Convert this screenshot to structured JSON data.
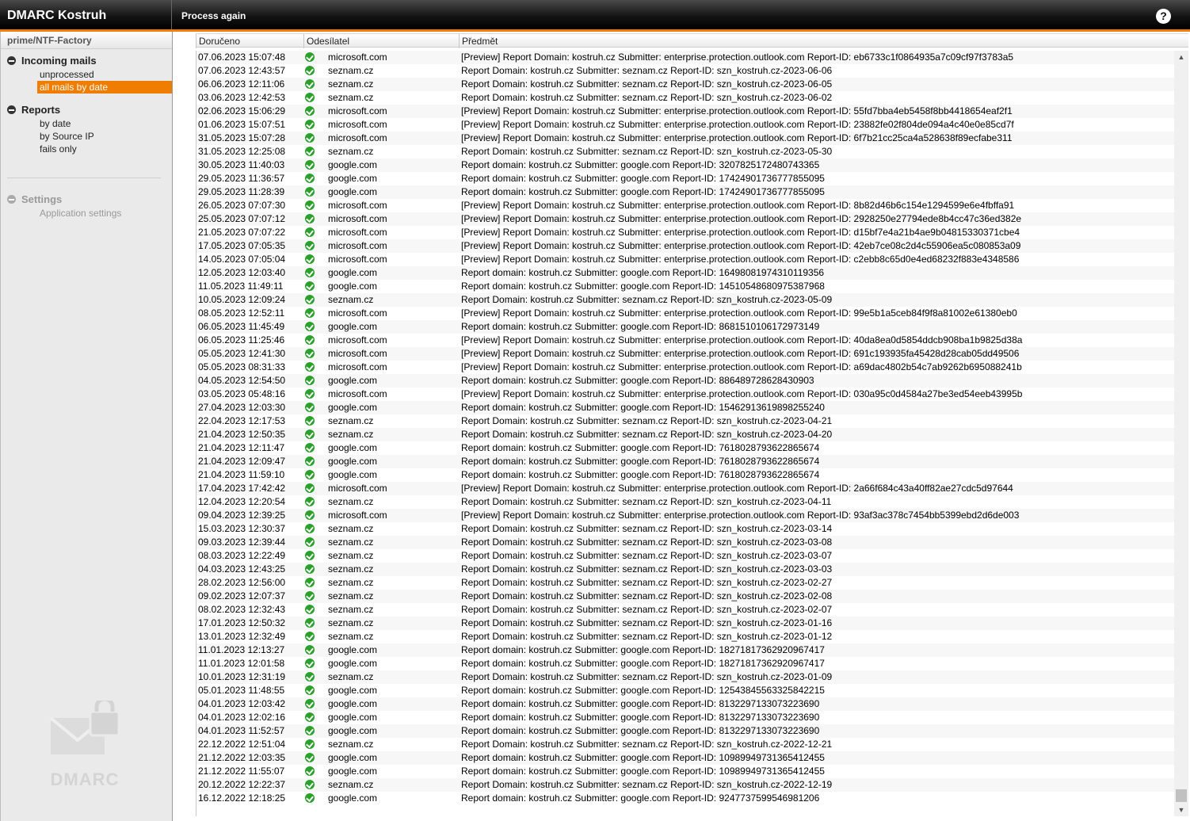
{
  "app": {
    "title": "DMARC Kostruh",
    "toolbar_action": "Process again",
    "help": "?"
  },
  "sidebar": {
    "instance": "prime/NTF-Factory",
    "sections": [
      {
        "title": "Incoming mails",
        "items": [
          "unprocessed",
          "all mails by date"
        ]
      },
      {
        "title": "Reports",
        "items": [
          "by date",
          "by Source IP",
          "fails only"
        ]
      },
      {
        "title": "Settings",
        "items": [
          "Application settings"
        ]
      }
    ],
    "logo_text": "DMARC"
  },
  "table": {
    "columns": [
      "Doručeno",
      "Odesílatel",
      "Předmět"
    ],
    "rows": [
      [
        "07.06.2023 15:07:48",
        "microsoft.com",
        "[Preview] Report Domain: kostruh.cz Submitter: enterprise.protection.outlook.com Report-ID: eb6733c1f0864935a7c09cf97f3783a5"
      ],
      [
        "07.06.2023 12:43:57",
        "seznam.cz",
        "Report Domain: kostruh.cz Submitter: seznam.cz Report-ID: szn_kostruh.cz-2023-06-06"
      ],
      [
        "06.06.2023 12:11:06",
        "seznam.cz",
        "Report Domain: kostruh.cz Submitter: seznam.cz Report-ID: szn_kostruh.cz-2023-06-05"
      ],
      [
        "03.06.2023 12:42:53",
        "seznam.cz",
        "Report Domain: kostruh.cz Submitter: seznam.cz Report-ID: szn_kostruh.cz-2023-06-02"
      ],
      [
        "02.06.2023 15:06:29",
        "microsoft.com",
        "[Preview] Report Domain: kostruh.cz Submitter: enterprise.protection.outlook.com Report-ID: 55fd7bba4eb5458f8bb4418654eaf2f1"
      ],
      [
        "01.06.2023 15:07:51",
        "microsoft.com",
        "[Preview] Report Domain: kostruh.cz Submitter: enterprise.protection.outlook.com Report-ID: 23882fe02f804de094a4c40e0e85cd7f"
      ],
      [
        "31.05.2023 15:07:28",
        "microsoft.com",
        "[Preview] Report Domain: kostruh.cz Submitter: enterprise.protection.outlook.com Report-ID: 6f7b21cc25ca4a528638f89ecfabe311"
      ],
      [
        "31.05.2023 12:25:08",
        "seznam.cz",
        "Report Domain: kostruh.cz Submitter: seznam.cz Report-ID: szn_kostruh.cz-2023-05-30"
      ],
      [
        "30.05.2023 11:40:03",
        "google.com",
        "Report domain: kostruh.cz Submitter: google.com Report-ID: 3207825172480743365"
      ],
      [
        "29.05.2023 11:36:57",
        "google.com",
        "Report domain: kostruh.cz Submitter: google.com Report-ID: 17424901736777855095"
      ],
      [
        "29.05.2023 11:28:39",
        "google.com",
        "Report domain: kostruh.cz Submitter: google.com Report-ID: 17424901736777855095"
      ],
      [
        "26.05.2023 07:07:30",
        "microsoft.com",
        "[Preview] Report Domain: kostruh.cz Submitter: enterprise.protection.outlook.com Report-ID: 8b82d46b6c154e1294599e6e4fbffa91"
      ],
      [
        "25.05.2023 07:07:12",
        "microsoft.com",
        "[Preview] Report Domain: kostruh.cz Submitter: enterprise.protection.outlook.com Report-ID: 2928250e27794ede8b4cc47c36ed382e"
      ],
      [
        "21.05.2023 07:07:22",
        "microsoft.com",
        "[Preview] Report Domain: kostruh.cz Submitter: enterprise.protection.outlook.com Report-ID: d15bf7e4a21b4ae9b04815330371cbe4"
      ],
      [
        "17.05.2023 07:05:35",
        "microsoft.com",
        "[Preview] Report Domain: kostruh.cz Submitter: enterprise.protection.outlook.com Report-ID: 42eb7ce08c2d4c55906ea5c080853a09"
      ],
      [
        "14.05.2023 07:05:04",
        "microsoft.com",
        "[Preview] Report Domain: kostruh.cz Submitter: enterprise.protection.outlook.com Report-ID: c2ebb8c65d0e4ed68232f883e4348586"
      ],
      [
        "12.05.2023 12:03:40",
        "google.com",
        "Report domain: kostruh.cz Submitter: google.com Report-ID: 16498081974310119356"
      ],
      [
        "11.05.2023 11:49:11",
        "google.com",
        "Report domain: kostruh.cz Submitter: google.com Report-ID: 14510548680975387968"
      ],
      [
        "10.05.2023 12:09:24",
        "seznam.cz",
        "Report Domain: kostruh.cz Submitter: seznam.cz Report-ID: szn_kostruh.cz-2023-05-09"
      ],
      [
        "08.05.2023 12:52:11",
        "microsoft.com",
        "[Preview] Report Domain: kostruh.cz Submitter: enterprise.protection.outlook.com Report-ID: 99e5b1a5ceb84f9f8a81002e61380eb0"
      ],
      [
        "06.05.2023 11:45:49",
        "google.com",
        "Report domain: kostruh.cz Submitter: google.com Report-ID: 8681510106172973149"
      ],
      [
        "06.05.2023 11:25:46",
        "microsoft.com",
        "[Preview] Report Domain: kostruh.cz Submitter: enterprise.protection.outlook.com Report-ID: 40da8ea0d5854ddcb908ba1b9825d38a"
      ],
      [
        "05.05.2023 12:41:30",
        "microsoft.com",
        "[Preview] Report Domain: kostruh.cz Submitter: enterprise.protection.outlook.com Report-ID: 691c193935fa45428d28cab05dd49506"
      ],
      [
        "05.05.2023 08:31:33",
        "microsoft.com",
        "[Preview] Report Domain: kostruh.cz Submitter: enterprise.protection.outlook.com Report-ID: a69dac4802b54c7ab9262b695088241b"
      ],
      [
        "04.05.2023 12:54:50",
        "google.com",
        "Report domain: kostruh.cz Submitter: google.com Report-ID: 886489728628430903"
      ],
      [
        "03.05.2023 05:48:16",
        "microsoft.com",
        "[Preview] Report Domain: kostruh.cz Submitter: enterprise.protection.outlook.com Report-ID: 030a95c0d4584a27be3ed54eeb43995b"
      ],
      [
        "27.04.2023 12:03:30",
        "google.com",
        "Report domain: kostruh.cz Submitter: google.com Report-ID: 15462913619898255240"
      ],
      [
        "22.04.2023 12:17:53",
        "seznam.cz",
        "Report Domain: kostruh.cz Submitter: seznam.cz Report-ID: szn_kostruh.cz-2023-04-21"
      ],
      [
        "21.04.2023 12:50:35",
        "seznam.cz",
        "Report Domain: kostruh.cz Submitter: seznam.cz Report-ID: szn_kostruh.cz-2023-04-20"
      ],
      [
        "21.04.2023 12:11:47",
        "google.com",
        "Report domain: kostruh.cz Submitter: google.com Report-ID: 7618028793622865674"
      ],
      [
        "21.04.2023 12:09:47",
        "google.com",
        "Report domain: kostruh.cz Submitter: google.com Report-ID: 7618028793622865674"
      ],
      [
        "21.04.2023 11:59:10",
        "google.com",
        "Report domain: kostruh.cz Submitter: google.com Report-ID: 7618028793622865674"
      ],
      [
        "17.04.2023 17:42:42",
        "microsoft.com",
        "[Preview] Report Domain: kostruh.cz Submitter: enterprise.protection.outlook.com Report-ID: 2a66f684c43a40ff82ae27cdc5d97644"
      ],
      [
        "12.04.2023 12:20:54",
        "seznam.cz",
        "Report Domain: kostruh.cz Submitter: seznam.cz Report-ID: szn_kostruh.cz-2023-04-11"
      ],
      [
        "09.04.2023 12:39:25",
        "microsoft.com",
        "[Preview] Report Domain: kostruh.cz Submitter: enterprise.protection.outlook.com Report-ID: 93af3ac378c7454bb5399ebd2d6de003"
      ],
      [
        "15.03.2023 12:30:37",
        "seznam.cz",
        "Report Domain: kostruh.cz Submitter: seznam.cz Report-ID: szn_kostruh.cz-2023-03-14"
      ],
      [
        "09.03.2023 12:39:44",
        "seznam.cz",
        "Report Domain: kostruh.cz Submitter: seznam.cz Report-ID: szn_kostruh.cz-2023-03-08"
      ],
      [
        "08.03.2023 12:22:49",
        "seznam.cz",
        "Report Domain: kostruh.cz Submitter: seznam.cz Report-ID: szn_kostruh.cz-2023-03-07"
      ],
      [
        "04.03.2023 12:43:25",
        "seznam.cz",
        "Report Domain: kostruh.cz Submitter: seznam.cz Report-ID: szn_kostruh.cz-2023-03-03"
      ],
      [
        "28.02.2023 12:56:00",
        "seznam.cz",
        "Report Domain: kostruh.cz Submitter: seznam.cz Report-ID: szn_kostruh.cz-2023-02-27"
      ],
      [
        "09.02.2023 12:07:37",
        "seznam.cz",
        "Report Domain: kostruh.cz Submitter: seznam.cz Report-ID: szn_kostruh.cz-2023-02-08"
      ],
      [
        "08.02.2023 12:32:43",
        "seznam.cz",
        "Report Domain: kostruh.cz Submitter: seznam.cz Report-ID: szn_kostruh.cz-2023-02-07"
      ],
      [
        "17.01.2023 12:50:32",
        "seznam.cz",
        "Report Domain: kostruh.cz Submitter: seznam.cz Report-ID: szn_kostruh.cz-2023-01-16"
      ],
      [
        "13.01.2023 12:32:49",
        "seznam.cz",
        "Report Domain: kostruh.cz Submitter: seznam.cz Report-ID: szn_kostruh.cz-2023-01-12"
      ],
      [
        "11.01.2023 12:13:27",
        "google.com",
        "Report domain: kostruh.cz Submitter: google.com Report-ID: 18271817362920967417"
      ],
      [
        "11.01.2023 12:01:58",
        "google.com",
        "Report domain: kostruh.cz Submitter: google.com Report-ID: 18271817362920967417"
      ],
      [
        "10.01.2023 12:31:19",
        "seznam.cz",
        "Report Domain: kostruh.cz Submitter: seznam.cz Report-ID: szn_kostruh.cz-2023-01-09"
      ],
      [
        "05.01.2023 11:48:55",
        "google.com",
        "Report domain: kostruh.cz Submitter: google.com Report-ID: 12543845563325842215"
      ],
      [
        "04.01.2023 12:03:42",
        "google.com",
        "Report domain: kostruh.cz Submitter: google.com Report-ID: 8132297133073223690"
      ],
      [
        "04.01.2023 12:02:16",
        "google.com",
        "Report domain: kostruh.cz Submitter: google.com Report-ID: 8132297133073223690"
      ],
      [
        "04.01.2023 11:52:57",
        "google.com",
        "Report domain: kostruh.cz Submitter: google.com Report-ID: 8132297133073223690"
      ],
      [
        "22.12.2022 12:51:04",
        "seznam.cz",
        "Report Domain: kostruh.cz Submitter: seznam.cz Report-ID: szn_kostruh.cz-2022-12-21"
      ],
      [
        "21.12.2022 12:03:35",
        "google.com",
        "Report domain: kostruh.cz Submitter: google.com Report-ID: 10989949731365412455"
      ],
      [
        "21.12.2022 11:55:07",
        "google.com",
        "Report domain: kostruh.cz Submitter: google.com Report-ID: 10989949731365412455"
      ],
      [
        "20.12.2022 12:22:37",
        "seznam.cz",
        "Report Domain: kostruh.cz Submitter: seznam.cz Report-ID: szn_kostruh.cz-2022-12-19"
      ],
      [
        "16.12.2022 12:18:25",
        "google.com",
        "Report domain: kostruh.cz Submitter: google.com Report-ID: 9247737599546981206"
      ]
    ]
  }
}
